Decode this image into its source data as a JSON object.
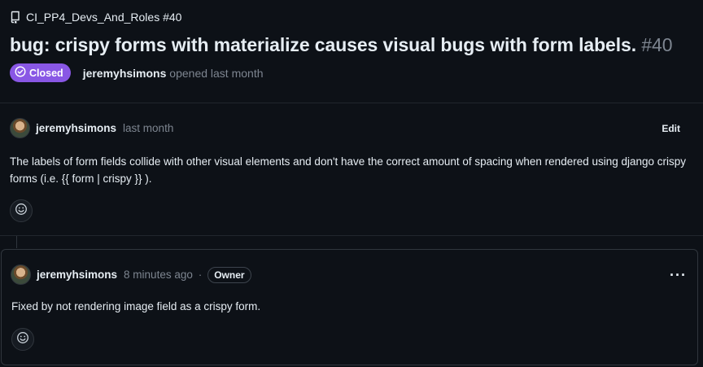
{
  "header": {
    "repo_crumb": "CI_PP4_Devs_And_Roles #40",
    "issue_title": "bug: crispy forms with materialize causes visual bugs with form labels.",
    "issue_number": "#40",
    "status_badge": "Closed",
    "author": "jeremyhsimons",
    "opened_text": "opened last month"
  },
  "comments": [
    {
      "author": "jeremyhsimons",
      "time": "last month",
      "action": "Edit",
      "body": "The labels of form fields collide with other visual elements and don't have the correct amount of spacing when rendered using django crispy forms (i.e. {{ form | crispy }} )."
    },
    {
      "author": "jeremyhsimons",
      "time": "8 minutes ago",
      "separator": "·",
      "role_badge": "Owner",
      "menu": "···",
      "body": "Fixed by not rendering image field as a crispy form."
    }
  ],
  "icons": [
    "repo-icon",
    "closed-check-icon",
    "smiley-icon",
    "kebab-menu-icon"
  ],
  "colors": {
    "background": "#0d1117",
    "closed_badge": "#8957e5",
    "muted_text": "#7d8590",
    "border": "#30363d"
  }
}
